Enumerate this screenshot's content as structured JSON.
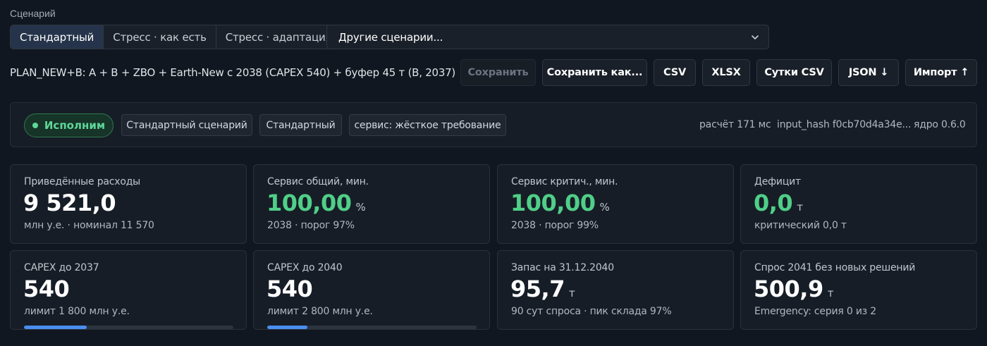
{
  "scenario": {
    "label": "Сценарий",
    "tabs": [
      {
        "label": "Стандартный",
        "active": true
      },
      {
        "label": "Стресс · как есть",
        "active": false
      },
      {
        "label": "Стресс · адаптация",
        "active": false
      }
    ],
    "other_select": "Другие сценарии..."
  },
  "plan": {
    "title": "PLAN_NEW+B: A + B + ZBO + Earth-New с 2038 (CAPEX 540) + буфер 45 т (B, 2037)"
  },
  "toolbar": {
    "save": "Сохранить",
    "save_as": "Сохранить как...",
    "csv": "CSV",
    "xlsx": "XLSX",
    "daily_csv": "Сутки CSV",
    "json": "JSON ↓",
    "import": "Импорт ↑"
  },
  "status": {
    "feasible": "Исполним",
    "tags": [
      "Стандартный сценарий",
      "Стандартный",
      "сервис: жёсткое требование"
    ],
    "calc_time": "расчёт 171 мс",
    "input_hash": "input_hash f0cb70d4a34e...",
    "core": "ядро 0.6.0"
  },
  "cards": [
    {
      "label": "Приведённые расходы",
      "value": "9 521,0",
      "unit": "",
      "sub": "млн у.е. · номинал 11 570",
      "green": false
    },
    {
      "label": "Сервис общий, мин.",
      "value": "100,00",
      "unit": "%",
      "sub": "2038 · порог 97%",
      "green": true
    },
    {
      "label": "Сервис критич., мин.",
      "value": "100,00",
      "unit": "%",
      "sub": "2038 · порог 99%",
      "green": true
    },
    {
      "label": "Дефицит",
      "value": "0,0",
      "unit": "т",
      "sub": "критический 0,0 т",
      "green": true
    },
    {
      "label": "CAPEX до 2037",
      "value": "540",
      "unit": "",
      "sub": "лимит 1 800 млн у.е.",
      "green": false,
      "progress": 0.3
    },
    {
      "label": "CAPEX до 2040",
      "value": "540",
      "unit": "",
      "sub": "лимит 2 800 млн у.е.",
      "green": false,
      "progress": 0.193
    },
    {
      "label": "Запас на 31.12.2040",
      "value": "95,7",
      "unit": "т",
      "sub": "90 сут спроса · пик склада 97%",
      "green": false
    },
    {
      "label": "Спрос 2041 без новых решений",
      "value": "500,9",
      "unit": "т",
      "sub": "Emergency: серия 0 из 2",
      "green": false
    }
  ],
  "colors": {
    "accent": "#4a8ef0",
    "success": "#4fcf88"
  }
}
